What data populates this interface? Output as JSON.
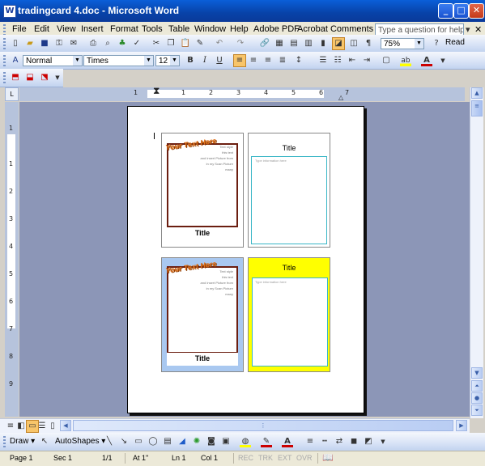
{
  "window": {
    "title": "tradingcard 4.doc - Microsoft Word",
    "app_icon": "W",
    "controls": {
      "minimize": "_",
      "maximize": "□",
      "close": "✕"
    }
  },
  "menu": {
    "items": [
      "File",
      "Edit",
      "View",
      "Insert",
      "Format",
      "Tools",
      "Table",
      "Window",
      "Help",
      "Adobe PDF",
      "Acrobat Comments"
    ],
    "help_placeholder": "Type a question for help",
    "help_dropdown": "▾",
    "close_doc": "✕"
  },
  "standard_toolbar": {
    "zoom": "75%",
    "read_label": "Read"
  },
  "formatting_toolbar": {
    "style": "Normal",
    "font": "Times",
    "size": "12",
    "bold": "B",
    "italic": "I",
    "underline": "U",
    "font_color_glyph": "A",
    "highlight_glyph": "ab"
  },
  "ruler": {
    "h_numbers": [
      "1",
      "1",
      "2",
      "3",
      "4",
      "5",
      "6",
      "7"
    ],
    "v_numbers": [
      "1",
      "1",
      "2",
      "3",
      "4",
      "5",
      "6",
      "7",
      "8",
      "9"
    ]
  },
  "cards": [
    {
      "banner": "Your Text Here",
      "title": "Title",
      "small_lines": [
        "Text style",
        "this text",
        "and Insert Picture from",
        "in my Scan Picture",
        "many"
      ]
    },
    {
      "title": "Title",
      "placeholder": "Type information here"
    },
    {
      "banner": "Your Text Here",
      "title": "Title",
      "small_lines": [
        "Text style",
        "this text",
        "and Insert Picture from",
        "in my Scan Picture",
        "many"
      ]
    },
    {
      "title": "Title",
      "placeholder": "Type information here"
    }
  ],
  "drawing_toolbar": {
    "draw": "Draw",
    "autoshapes": "AutoShapes"
  },
  "status_bar": {
    "page": "Page 1",
    "section": "Sec 1",
    "page_of": "1/1",
    "at": "At 1\"",
    "line": "Ln 1",
    "col": "Col 1",
    "rec": "REC",
    "trk": "TRK",
    "ext": "EXT",
    "ovr": "OVR"
  },
  "colors": {
    "titlebar": "#0842a8",
    "card3_bg": "#a9c8f0",
    "card4_bg": "#ffff00",
    "card_border_dark": "#6b1e10",
    "card_border_teal": "#38b6c6"
  }
}
